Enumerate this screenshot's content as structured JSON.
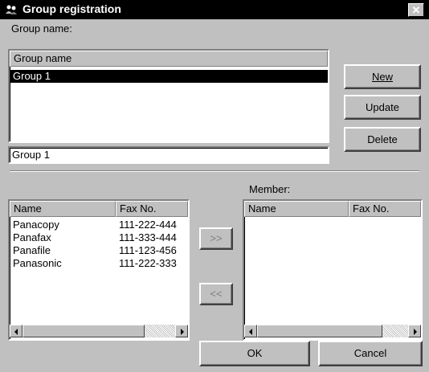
{
  "window": {
    "title": "Group registration",
    "close_glyph": "✕",
    "title_icon": "group-people-icon"
  },
  "group_section": {
    "label": "Group name:",
    "list_header": "Group name",
    "groups": [
      "Group 1"
    ],
    "selected_index": 0,
    "name_field_value": "Group 1"
  },
  "buttons": {
    "new_label": "New",
    "update_label": "Update",
    "delete_label": "Delete",
    "add_label": ">>",
    "remove_label": "<<",
    "ok_label": "OK",
    "cancel_label": "Cancel"
  },
  "directory": {
    "columns": [
      "Name",
      "Fax No."
    ],
    "rows": [
      {
        "name": "Panacopy",
        "fax": "111-222-444"
      },
      {
        "name": "Panafax",
        "fax": "111-333-444"
      },
      {
        "name": "Panafile",
        "fax": "111-123-456"
      },
      {
        "name": "Panasonic",
        "fax": "111-222-333"
      }
    ]
  },
  "member": {
    "label": "Member:",
    "columns": [
      "Name",
      "Fax No."
    ],
    "rows": []
  },
  "colors": {
    "selection": "#000000",
    "face": "#c0c0c0"
  }
}
